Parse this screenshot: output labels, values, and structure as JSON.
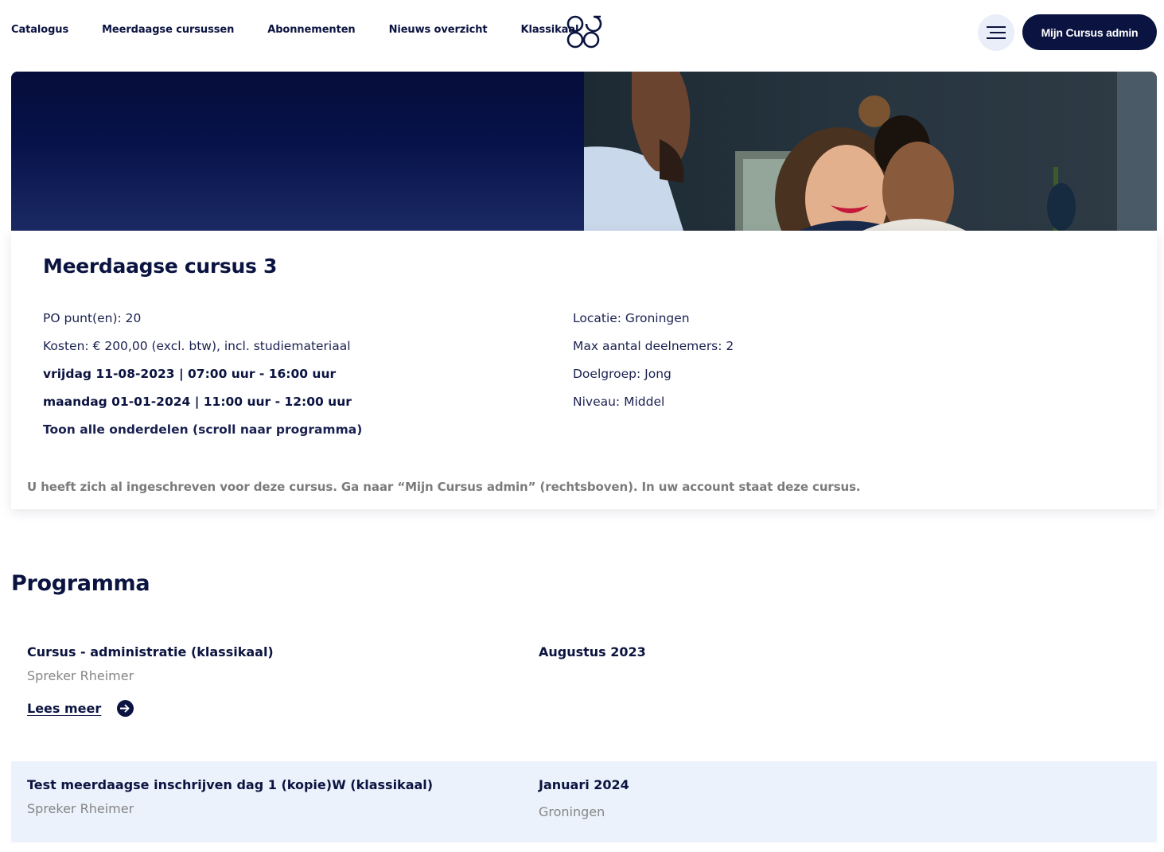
{
  "nav": {
    "items": [
      {
        "label": "Catalogus"
      },
      {
        "label": "Meerdaagse cursussen"
      },
      {
        "label": "Abonnementen"
      },
      {
        "label": "Nieuws overzicht"
      },
      {
        "label": "Klassikaal"
      }
    ],
    "logo_icon": "brand-logo-icon",
    "menu_icon": "hamburger-menu-icon",
    "admin_button": "Mijn Cursus admin"
  },
  "hero": {
    "image": "photo-of-smiling-people-at-office"
  },
  "course": {
    "title": "Meerdaagse cursus 3",
    "left": {
      "po_points": "PO punt(en): 20",
      "costs": "Kosten: € 200,00 (excl. btw), incl. studiemateriaal",
      "date1": "vrijdag 11-08-2023 | 07:00 uur - 16:00 uur",
      "date2": "maandag 01-01-2024 | 11:00 uur - 12:00 uur",
      "show_all": "Toon alle onderdelen (scroll naar programma)"
    },
    "right": {
      "location": "Locatie: Groningen",
      "max_participants": "Max aantal deelnemers: 2",
      "target_group": "Doelgroep: Jong",
      "level": "Niveau: Middel"
    },
    "notice": "U heeft zich al ingeschreven voor deze cursus. Ga naar “Mijn Cursus admin” (rechtsboven). In uw account staat deze cursus."
  },
  "programma": {
    "title": "Programma",
    "items": [
      {
        "title": "Cursus - administratie (klassikaal)",
        "speaker": "Spreker Rheimer",
        "date": "Augustus 2023",
        "read_more": "Lees meer"
      },
      {
        "title": "Test meerdaagse inschrijven dag 1 (kopie)W (klassikaal)",
        "speaker": "Spreker Rheimer",
        "date": "Januari 2024",
        "location": "Groningen"
      }
    ]
  },
  "colors": {
    "primary": "#0b1340",
    "muted": "#858585",
    "row_highlight": "#ebf2fc",
    "menu_bg": "#e9eef8"
  }
}
